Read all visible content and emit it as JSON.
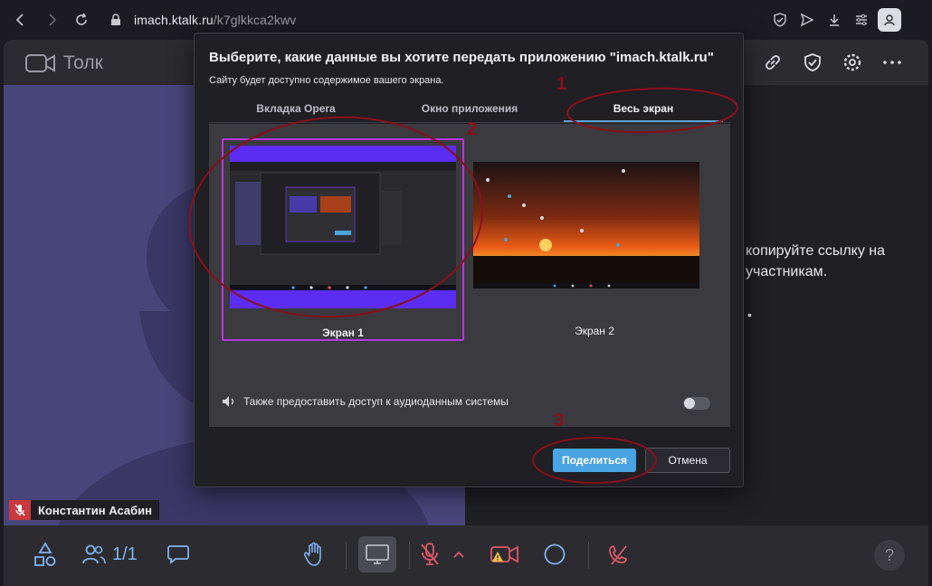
{
  "browser": {
    "url_host": "imach.ktalk.ru",
    "url_path": "/k7glkkca2kwv"
  },
  "app": {
    "brand": "Толк",
    "participant_name": "Константин Асабин",
    "participants_count": "1/1",
    "invite_text_line1": "копируйте ссылку на",
    "invite_text_line2": "участникам.",
    "invite_fragment": "•",
    "help_label": "?"
  },
  "dialog": {
    "title": "Выберите, какие данные вы хотите передать приложению \"imach.ktalk.ru\"",
    "subtitle": "Сайту будет доступно содержимое вашего экрана.",
    "tabs": [
      {
        "label": "Вкладка Opera",
        "active": false
      },
      {
        "label": "Окно приложения",
        "active": false
      },
      {
        "label": "Весь экран",
        "active": true
      }
    ],
    "screens": [
      {
        "label": "Экран 1",
        "selected": true
      },
      {
        "label": "Экран 2",
        "selected": false
      }
    ],
    "audio_label": "Также предоставить доступ к аудиоданным системы",
    "audio_enabled": false,
    "share_button": "Поделиться",
    "cancel_button": "Отмена"
  },
  "annotations": {
    "marker_1": "1",
    "marker_2": "2",
    "marker_3": "3",
    "color": "#8a0f1c"
  },
  "colors": {
    "accent": "#4aa3e2",
    "selection": "#b637e0",
    "danger": "#c83a40"
  }
}
